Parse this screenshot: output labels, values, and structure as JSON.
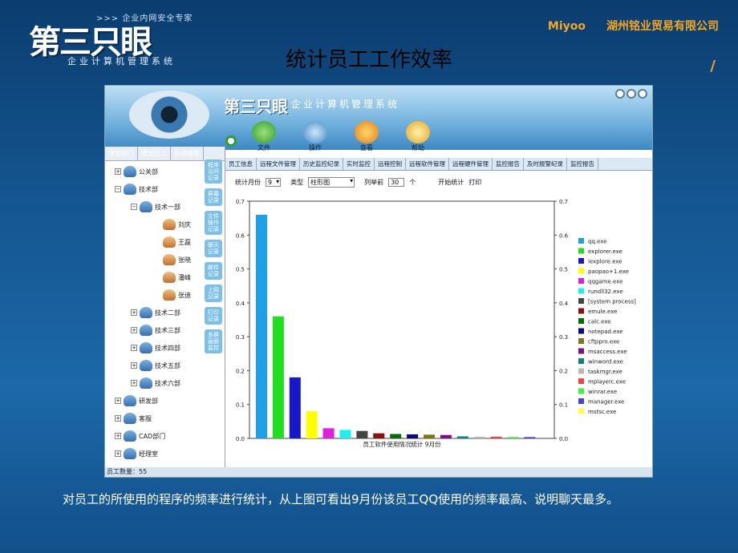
{
  "brand": {
    "slogan": ">>> 企业内网安全专家",
    "logo": "第三只眼",
    "sub": "企业计算机管理系统"
  },
  "company": {
    "name1": "Miyoo",
    "name2": "湖州铭业贸易有限公司",
    "mark": "/"
  },
  "page_title": "统计员工工作效率",
  "app": {
    "logo": "第三只眼",
    "sub": "企业计算机管理系统",
    "toolbar": [
      "文件",
      "操作",
      "查看",
      "帮助"
    ],
    "left_tabs": [
      "增加部门",
      "增加员工",
      "自动搜索"
    ],
    "tree": [
      {
        "label": "公关部",
        "sign": "+"
      },
      {
        "label": "技术部",
        "sign": "−"
      },
      {
        "label": "技术一部",
        "sign": "−"
      },
      {
        "label": "刘庆"
      },
      {
        "label": "王磊"
      },
      {
        "label": "张晓"
      },
      {
        "label": "潘峰"
      },
      {
        "label": "张迪"
      },
      {
        "label": "技术二部",
        "sign": "+"
      },
      {
        "label": "技术三部",
        "sign": "+"
      },
      {
        "label": "技术四部",
        "sign": "+"
      },
      {
        "label": "技术五部",
        "sign": "+"
      },
      {
        "label": "技术六部",
        "sign": "+"
      },
      {
        "label": "研发部",
        "sign": "+"
      },
      {
        "label": "客服",
        "sign": "+"
      },
      {
        "label": "CAD部门",
        "sign": "+"
      },
      {
        "label": "经理室",
        "sign": "+"
      }
    ],
    "side_tabs": [
      "程序访问记录",
      "屏幕记录",
      "文件操作记录",
      "聊天记录",
      "邮件记录",
      "上网记录",
      "打印记录",
      "多屏画面监控"
    ],
    "tabs": [
      "员工信息",
      "远程文件管理",
      "历史监控纪录",
      "实时监控",
      "远程控制",
      "远程软件管理",
      "远程硬件管理",
      "监控报告",
      "及时报警纪录",
      "监控报告"
    ],
    "controls": {
      "month_label": "统计月份",
      "month": "9",
      "type_label": "类型",
      "type": "柱形图",
      "top_label": "列举前",
      "top": "30",
      "unit": "个",
      "start": "开始统计",
      "print": "打印"
    },
    "status": "员工数量：55"
  },
  "chart_data": {
    "type": "bar",
    "title": "员工软件使用情况统计 9月份",
    "ylim": [
      0,
      0.7
    ],
    "yticks": [
      "0.0",
      "0.1",
      "0.2",
      "0.3",
      "0.4",
      "0.5",
      "0.6",
      "0.7"
    ],
    "legend_position": "right",
    "series": [
      {
        "name": "qq.exe",
        "value": 0.66,
        "color": "#1ea0e8"
      },
      {
        "name": "explorer.exe",
        "value": 0.36,
        "color": "#22dd22"
      },
      {
        "name": "iexplore.exe",
        "value": 0.18,
        "color": "#1818c8"
      },
      {
        "name": "paopao+1.exe",
        "value": 0.08,
        "color": "#ffff00"
      },
      {
        "name": "qqgame.exe",
        "value": 0.03,
        "color": "#dd22dd"
      },
      {
        "name": "rundll32.exe",
        "value": 0.025,
        "color": "#22eeee"
      },
      {
        "name": "[system process]",
        "value": 0.022,
        "color": "#444444"
      },
      {
        "name": "emule.exe",
        "value": 0.015,
        "color": "#8a1010"
      },
      {
        "name": "calc.exe",
        "value": 0.013,
        "color": "#0a6a0a"
      },
      {
        "name": "notepad.exe",
        "value": 0.012,
        "color": "#0a0a80"
      },
      {
        "name": "cftppro.exe",
        "value": 0.011,
        "color": "#7a7a10"
      },
      {
        "name": "msaccess.exe",
        "value": 0.01,
        "color": "#801080"
      },
      {
        "name": "winword.exe",
        "value": 0.006,
        "color": "#108080"
      },
      {
        "name": "taskmgr.exe",
        "value": 0.005,
        "color": "#b8b8b8"
      },
      {
        "name": "mplayerc.exe",
        "value": 0.005,
        "color": "#ee4444"
      },
      {
        "name": "winrar.exe",
        "value": 0.004,
        "color": "#44ee44"
      },
      {
        "name": "manager.exe",
        "value": 0.004,
        "color": "#4444ee"
      },
      {
        "name": "mstsc.exe",
        "value": 0.0,
        "color": "#ffff44"
      }
    ]
  },
  "caption": "对员工的所使用的程序的频率进行统计，从上图可看出9月份该员工QQ使用的频率最高、说明聊天最多。"
}
